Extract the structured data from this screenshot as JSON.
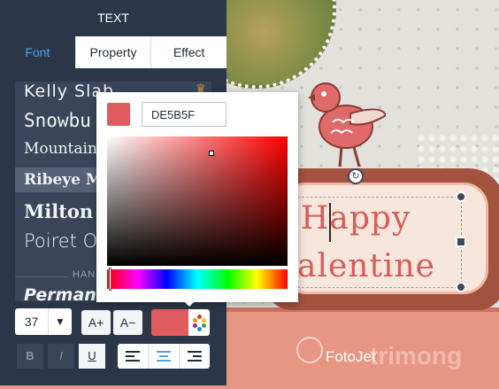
{
  "panel": {
    "title": "TEXT",
    "tabs": [
      {
        "label": "Font"
      },
      {
        "label": "Property"
      },
      {
        "label": "Effect"
      }
    ],
    "fonts": [
      {
        "name": "Kelly Slab"
      },
      {
        "name": "Snowbu"
      },
      {
        "name": "Mountains"
      },
      {
        "name": "Ribeye M"
      },
      {
        "name": "Milton"
      },
      {
        "name": "Poiret O"
      },
      {
        "name": "Permanent Mark"
      }
    ],
    "section_label": "HAN",
    "font_size": "37",
    "size_increase": "A+",
    "size_decrease": "A−",
    "bold": "B",
    "italic": "I",
    "underline": "U"
  },
  "color_picker": {
    "hex_value": "DE5B5F",
    "color": "#de5b5f"
  },
  "canvas": {
    "line1": "Happy",
    "line2": "alentine",
    "brand": "FotoJet",
    "watermark": "trimong"
  }
}
